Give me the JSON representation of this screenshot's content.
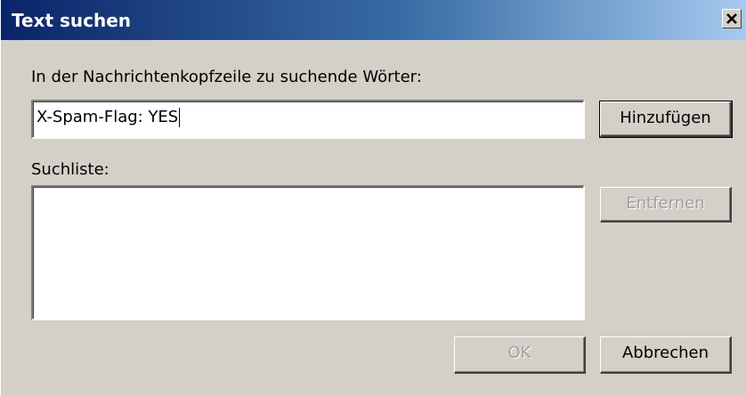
{
  "window": {
    "title": "Text suchen",
    "close_glyph": "✕"
  },
  "header_words": {
    "label": "In der Nachrichtenkopfzeile zu suchende Wörter:",
    "value": "X-Spam-Flag: YES"
  },
  "search_list": {
    "label": "Suchliste:",
    "items": []
  },
  "buttons": {
    "add": "Hinzufügen",
    "remove": "Entfernen",
    "ok": "OK",
    "cancel": "Abbrechen"
  },
  "colors": {
    "titlebar_start": "#0a246a",
    "titlebar_end": "#a6caf0",
    "dialog_face": "#d4d0c8",
    "disabled_text": "#a0a0a0"
  },
  "icons": {
    "close": "close-icon"
  }
}
